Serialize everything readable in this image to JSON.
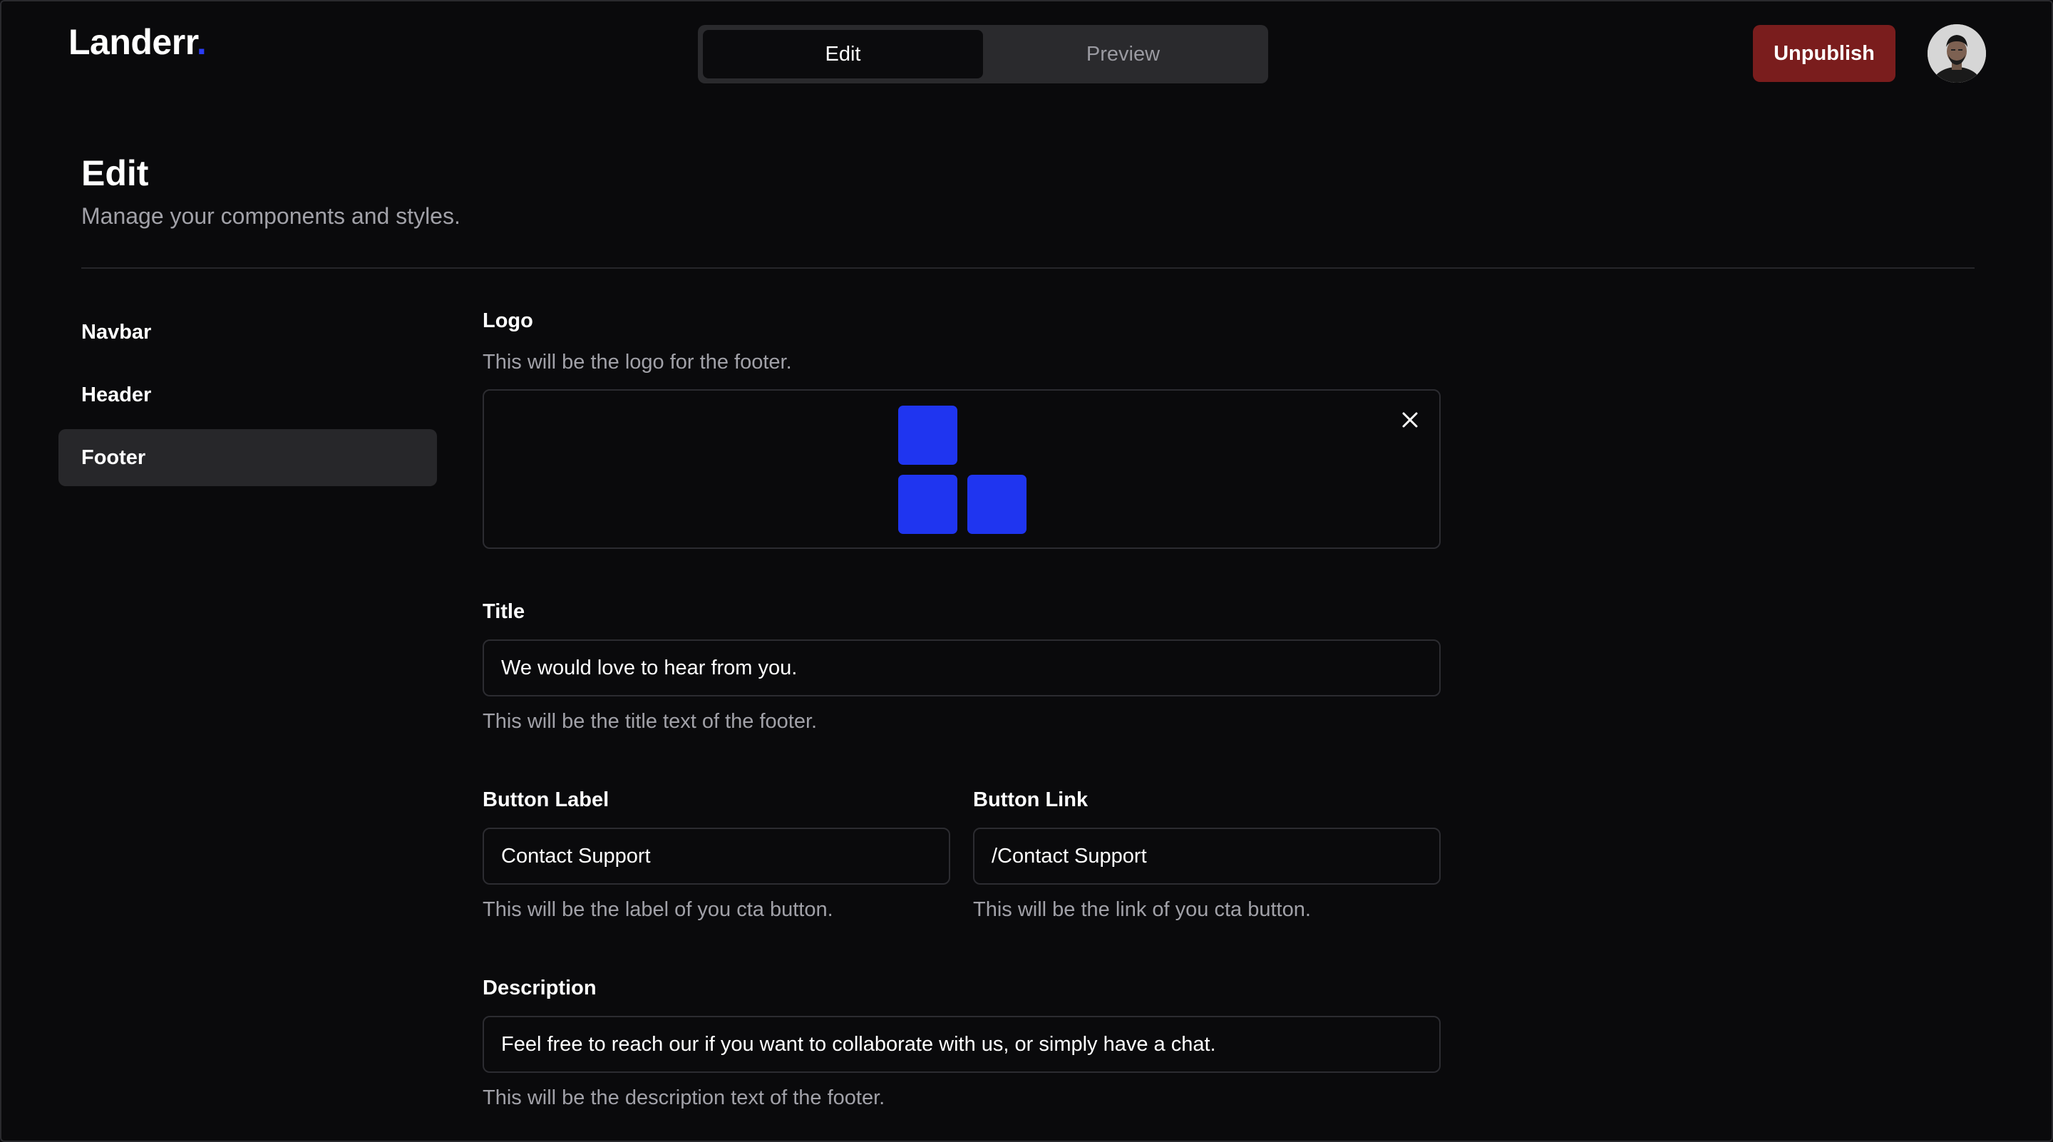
{
  "app": {
    "brand_name": "Landerr",
    "brand_dot": ".",
    "brand_accent_color": "#2a3cf5"
  },
  "topbar": {
    "tabs": [
      {
        "label": "Edit",
        "active": true
      },
      {
        "label": "Preview",
        "active": false
      }
    ],
    "unpublish_label": "Unpublish",
    "unpublish_color": "#7a1d1d",
    "avatar_icon": "user-avatar"
  },
  "page": {
    "title": "Edit",
    "subtitle": "Manage your components and styles."
  },
  "sidebar": {
    "items": [
      {
        "label": "Navbar",
        "active": false
      },
      {
        "label": "Header",
        "active": false
      },
      {
        "label": "Footer",
        "active": true
      }
    ]
  },
  "form": {
    "logo": {
      "label": "Logo",
      "help": "This will be the logo for the footer.",
      "logo_color": "#1f35f0",
      "remove_icon": "close-icon"
    },
    "title": {
      "label": "Title",
      "value": "We would love to hear from you.",
      "help": "This will be the title text of the footer."
    },
    "button_label": {
      "label": "Button Label",
      "value": "Contact Support",
      "help": "This will be the label of you cta button."
    },
    "button_link": {
      "label": "Button Link",
      "value": "/Contact Support",
      "help": "This will be the link of you cta button."
    },
    "description": {
      "label": "Description",
      "value": "Feel free to reach our if you want to collaborate with us, or simply have a chat.",
      "help": "This will be the description text of the footer."
    }
  }
}
